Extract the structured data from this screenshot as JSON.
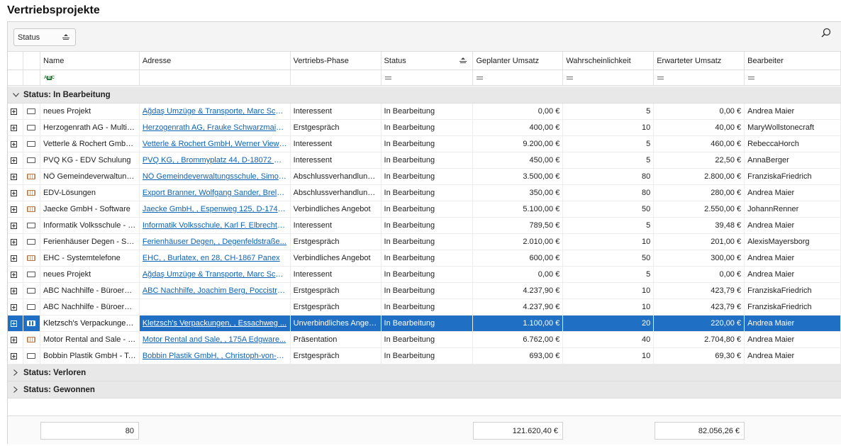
{
  "page": {
    "title": "Vertriebsprojekte"
  },
  "group_panel": {
    "chip_label": "Status"
  },
  "columns": [
    "Name",
    "Adresse",
    "Vertriebs-Phase",
    "Status",
    "Geplanter Umsatz",
    "Wahrscheinlichkeit",
    "Erwarteter Umsatz",
    "Bearbeiter"
  ],
  "groups": [
    {
      "label": "Status: In Bearbeitung",
      "expanded": true
    },
    {
      "label": "Status: Verloren",
      "expanded": false
    },
    {
      "label": "Status: Gewonnen",
      "expanded": false
    }
  ],
  "rows": [
    {
      "icon": "doc-icon",
      "name": "neues Projekt",
      "address": "Ağdaş Umzüge & Transporte, Marc Schoen, ...",
      "phase": "Interessent",
      "status": "In Bearbeitung",
      "planned": "0,00 €",
      "prob": "5",
      "expected": "0,00 €",
      "owner": "Andrea Maier"
    },
    {
      "icon": "doc-icon",
      "name": "Herzogenrath AG - Multifunktion",
      "address": "Herzogenrath AG, Frauke Schwarzmaier, ...",
      "phase": "Erstgespräch",
      "status": "In Bearbeitung",
      "planned": "400,00 €",
      "prob": "10",
      "expected": "40,00 €",
      "owner": "MaryWollstonecraft"
    },
    {
      "icon": "doc-icon",
      "name": "Vetterle & Rochert GmbH - ...",
      "address": "Vetterle & Rochert GmbH, Werner Viewe...",
      "phase": "Interessent",
      "status": "In Bearbeitung",
      "planned": "9.200,00 €",
      "prob": "5",
      "expected": "460,00 €",
      "owner": "RebeccaHorch"
    },
    {
      "icon": "doc-icon",
      "name": "PVQ KG - EDV Schulung",
      "address": "PVQ KG,  , Brommyplatz 44, D-18072 Ro...",
      "phase": "Interessent",
      "status": "In Bearbeitung",
      "planned": "450,00 €",
      "prob": "5",
      "expected": "22,50 €",
      "owner": "AnnaBerger"
    },
    {
      "icon": "doc-icon-striped",
      "name": "NÖ Gemeindeverwaltungsschule",
      "address": "NÖ Gemeindeverwaltungsschule, Simon ...",
      "phase": "Abschlussverhandlungen",
      "status": "In Bearbeitung",
      "planned": "3.500,00 €",
      "prob": "80",
      "expected": "2.800,00 €",
      "owner": "FranziskaFriedrich"
    },
    {
      "icon": "doc-icon-striped",
      "name": "EDV-Lösungen",
      "address": "Export Branner, Wolfgang Sander, Brelo...",
      "phase": "Abschlussverhandlungen",
      "status": "In Bearbeitung",
      "planned": "350,00 €",
      "prob": "80",
      "expected": "280,00 €",
      "owner": "Andrea Maier"
    },
    {
      "icon": "doc-icon-striped",
      "name": "Jaecke GmbH - Software",
      "address": "Jaecke GmbH,  , Espenweg 125, D-1744...",
      "phase": "Verbindliches Angebot",
      "status": "In Bearbeitung",
      "planned": "5.100,00 €",
      "prob": "50",
      "expected": "2.550,00 €",
      "owner": "JohannRenner"
    },
    {
      "icon": "doc-icon",
      "name": "Informatik Volksschule - IT-Service",
      "address": "Informatik Volksschule, Karl F. Elbrecht, ...",
      "phase": "Interessent",
      "status": "In Bearbeitung",
      "planned": "789,50 €",
      "prob": "5",
      "expected": "39,48 €",
      "owner": "Andrea Maier"
    },
    {
      "icon": "doc-icon",
      "name": "Ferienhäuser Degen - Software",
      "address": "Ferienhäuser Degen,  , Degenfeldstraße...",
      "phase": "Erstgespräch",
      "status": "In Bearbeitung",
      "planned": "2.010,00 €",
      "prob": "10",
      "expected": "201,00 €",
      "owner": "AlexisMayersborg"
    },
    {
      "icon": "doc-icon-striped",
      "name": "EHC - Systemtelefone",
      "address": "EHC,  , Burlatex, en 28, CH-1867 Panex",
      "phase": "Verbindliches Angebot",
      "status": "In Bearbeitung",
      "planned": "600,00 €",
      "prob": "50",
      "expected": "300,00 €",
      "owner": "Andrea Maier"
    },
    {
      "icon": "doc-icon",
      "name": "neues Projekt",
      "address": "Ağdaş Umzüge & Transporte, Marc Schoen, ...",
      "phase": "Interessent",
      "status": "In Bearbeitung",
      "planned": "0,00 €",
      "prob": "5",
      "expected": "0,00 €",
      "owner": "Andrea Maier"
    },
    {
      "icon": "doc-icon",
      "name": "ABC Nachhilfe - Büroerweiterung",
      "address": "ABC Nachhilfe, Joachim Berg, Poccistraße...",
      "phase": "Erstgespräch",
      "status": "In Bearbeitung",
      "planned": "4.237,90 €",
      "prob": "10",
      "expected": "423,79 €",
      "owner": "FranziskaFriedrich"
    },
    {
      "icon": "doc-icon",
      "name": "ABC Nachhilfe - Büroerweiterung",
      "address": "",
      "phase": "Erstgespräch",
      "status": "In Bearbeitung",
      "planned": "4.237,90 €",
      "prob": "10",
      "expected": "423,79 €",
      "owner": "FranziskaFriedrich"
    },
    {
      "icon": "doc-icon",
      "name": "Kletzsch's Verpackungen - Server",
      "address": "Kletzsch's Verpackungen,  , Essachweg ...",
      "phase": "Unverbindliches Angebot",
      "status": "In Bearbeitung",
      "planned": "1.100,00 €",
      "prob": "20",
      "expected": "220,00 €",
      "owner": "Andrea Maier",
      "selected": true
    },
    {
      "icon": "doc-icon-striped",
      "name": "Motor Rental and Sale - Software",
      "address": "Motor Rental and Sale,  , 175A Edgware...",
      "phase": "Präsentation",
      "status": "In Bearbeitung",
      "planned": "6.762,00 €",
      "prob": "40",
      "expected": "2.704,80 €",
      "owner": "Andrea Maier"
    },
    {
      "icon": "doc-icon",
      "name": "Bobbin Plastik GmbH - Telefonanlage",
      "address": "Bobbin Plastik GmbH,  , Christoph-von-Gl...",
      "phase": "Erstgespräch",
      "status": "In Bearbeitung",
      "planned": "693,00 €",
      "prob": "10",
      "expected": "69,30 €",
      "owner": "Andrea Maier"
    }
  ],
  "footer": {
    "count": "80",
    "planned_total": "121.620,40 €",
    "expected_total": "82.056,26 €"
  }
}
